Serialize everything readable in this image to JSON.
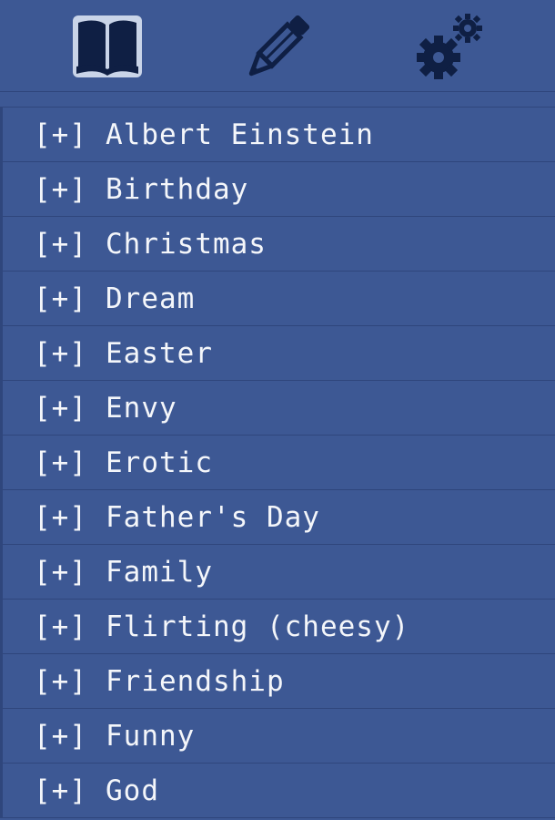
{
  "toolbar": {
    "icons": [
      "book-icon",
      "pencil-icon",
      "gears-icon"
    ],
    "colors": {
      "icon": "#0f1f44",
      "icon_highlight": "#c9d4e8",
      "background": "#3d5894",
      "divider": "#2f467c"
    }
  },
  "list": {
    "prefix": "[+]",
    "items": [
      {
        "label": "Albert Einstein"
      },
      {
        "label": "Birthday"
      },
      {
        "label": "Christmas"
      },
      {
        "label": "Dream"
      },
      {
        "label": "Easter"
      },
      {
        "label": "Envy"
      },
      {
        "label": "Erotic"
      },
      {
        "label": "Father's Day"
      },
      {
        "label": "Family"
      },
      {
        "label": "Flirting (cheesy)"
      },
      {
        "label": "Friendship"
      },
      {
        "label": "Funny"
      },
      {
        "label": "God"
      }
    ]
  }
}
